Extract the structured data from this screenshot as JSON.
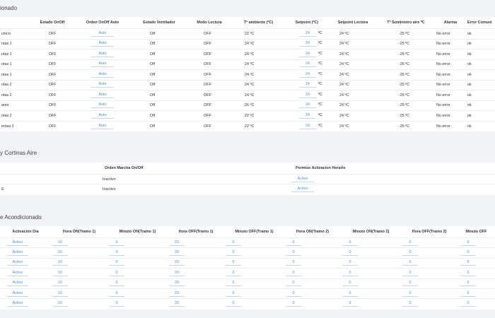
{
  "section1": {
    "title": "ionado",
    "columns": [
      "",
      "Estado OnOff",
      "Orden OnOff Auto",
      "Estado Ventilador",
      "Modo Lectura",
      "Tª ambiente (ºC)",
      "Setpoint (ºC)",
      "Setpoint Lectura",
      "Tª Suministro aire ºC",
      "Alarma",
      "Error Comuni"
    ],
    "rows": [
      {
        "name": "ctrico",
        "estado": "OFF",
        "orden": "Auto",
        "vent": "Off",
        "modo": "OFF",
        "tamb": "22 ºC",
        "sp": "24",
        "spunit": "ºC",
        "splect": "24 ºC",
        "tsum": "-25 ºC",
        "alarma": "No error",
        "error": "ok"
      },
      {
        "name": "ntas 1",
        "estado": "OFF",
        "orden": "Auto",
        "vent": "Off",
        "modo": "OFF",
        "tamb": "24 ºC",
        "sp": "24",
        "spunit": "ºC",
        "splect": "24 ºC",
        "tsum": "-25 ºC",
        "alarma": "No error",
        "error": "ok"
      },
      {
        "name": "ntas 1",
        "estado": "OFF",
        "orden": "Auto",
        "vent": "Off",
        "modo": "OFF",
        "tamb": "24 ºC",
        "sp": "24",
        "spunit": "ºC",
        "splect": "24 ºC",
        "tsum": "-25 ºC",
        "alarma": "No error",
        "error": "ok"
      },
      {
        "name": "ntas 1",
        "estado": "OFF",
        "orden": "Auto",
        "vent": "Off",
        "modo": "OFF",
        "tamb": "24 ºC",
        "sp": "24",
        "spunit": "ºC",
        "splect": "24 ºC",
        "tsum": "-25 ºC",
        "alarma": "No error",
        "error": "ok"
      },
      {
        "name": "ntas 1",
        "estado": "OFF",
        "orden": "Auto",
        "vent": "Off",
        "modo": "OFF",
        "tamb": "24 ºC",
        "sp": "24",
        "spunit": "ºC",
        "splect": "24 ºC",
        "tsum": "-25 ºC",
        "alarma": "No error",
        "error": "ok"
      },
      {
        "name": "ntas 2",
        "estado": "OFF",
        "orden": "Auto",
        "vent": "Off",
        "modo": "OFF",
        "tamb": "24 ºC",
        "sp": "24",
        "spunit": "ºC",
        "splect": "24 ºC",
        "tsum": "-25 ºC",
        "alarma": "No error",
        "error": "ok"
      },
      {
        "name": "ntas 2",
        "estado": "OFF",
        "orden": "Auto",
        "vent": "Off",
        "modo": "OFF",
        "tamb": "24 ºC",
        "sp": "24",
        "spunit": "ºC",
        "splect": "24 ºC",
        "tsum": "-25 ºC",
        "alarma": "No error",
        "error": "ok"
      },
      {
        "name": "ares",
        "estado": "OFF",
        "orden": "Auto",
        "vent": "Off",
        "modo": "OFF",
        "tamb": "26 ºC",
        "sp": "24",
        "spunit": "ºC",
        "splect": "24 ºC",
        "tsum": "-25 ºC",
        "alarma": "No error",
        "error": "ok"
      },
      {
        "name": "ntas 2",
        "estado": "OFF",
        "orden": "Auto",
        "vent": "Off",
        "modo": "OFF",
        "tamb": "22 ºC",
        "sp": "24",
        "spunit": "ºC",
        "splect": "24 ºC",
        "tsum": "-25 ºC",
        "alarma": "No error",
        "error": "ok"
      },
      {
        "name": "entas 2",
        "estado": "OFF",
        "orden": "Auto",
        "vent": "Off",
        "modo": "OFF",
        "tamb": "22 ºC",
        "sp": "24",
        "spunit": "ºC",
        "splect": "24 ºC",
        "tsum": "-25 ºC",
        "alarma": "No error",
        "error": "ok"
      }
    ]
  },
  "section2": {
    "title": "y Cortinas Aire",
    "columns": [
      "",
      "Orden Marcha On/Off",
      "Permiso Activacion Horario"
    ],
    "rows": [
      {
        "name": "",
        "orden": "Inactivo",
        "permiso": "Activo"
      },
      {
        "name": "E",
        "orden": "Inactivo",
        "permiso": "Activo"
      }
    ]
  },
  "section3": {
    "title": "e Acondicionado",
    "columns": [
      "Activación Día",
      "Hora ON(Tramo 1)",
      "Minuto ON(Tramo 1)",
      "Hora OFF(Tramo 1)",
      "Minuto OFF(Tramo 1)",
      "Hora ON(Tramo 2)",
      "Minuto ON(Tramo 2)",
      "Hora OFF(Tramo 2)",
      "Minuto OFF"
    ],
    "rows": [
      [
        "Activo",
        "10",
        "0",
        "20",
        "0",
        "0",
        "0",
        "0",
        "0"
      ],
      [
        "Activo",
        "10",
        "0",
        "20",
        "0",
        "0",
        "0",
        "0",
        "0"
      ],
      [
        "Activo",
        "10",
        "0",
        "20",
        "0",
        "0",
        "0",
        "0",
        "0"
      ],
      [
        "Activo",
        "10",
        "0",
        "20",
        "0",
        "0",
        "0",
        "0",
        "0"
      ],
      [
        "Activo",
        "10",
        "0",
        "20",
        "0",
        "0",
        "0",
        "0",
        "0"
      ],
      [
        "Activo",
        "10",
        "0",
        "20",
        "0",
        "0",
        "0",
        "0",
        "0"
      ],
      [
        "Activo",
        "10",
        "0",
        "20",
        "0",
        "0",
        "0",
        "0",
        "0"
      ]
    ]
  },
  "colors": {
    "link": "#4a90d9",
    "panel": "#ffffff",
    "page": "#f2f3f6"
  }
}
